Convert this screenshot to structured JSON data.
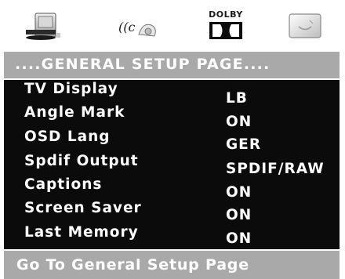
{
  "icons": [
    {
      "name": "general-setup-icon"
    },
    {
      "name": "audio-setup-icon"
    },
    {
      "name": "dolby-icon"
    },
    {
      "name": "preference-icon"
    }
  ],
  "dolby_label": "DOLBY",
  "page_title": "....GENERAL SETUP PAGE....",
  "menu": {
    "items": [
      {
        "label": "TV Display",
        "value": "LB"
      },
      {
        "label": "Angle Mark",
        "value": "ON"
      },
      {
        "label": "OSD Lang",
        "value": "GER"
      },
      {
        "label": "Spdif Output",
        "value": "SPDIF/RAW"
      },
      {
        "label": "Captions",
        "value": "ON"
      },
      {
        "label": "Screen Saver",
        "value": "ON"
      },
      {
        "label": "Last Memory",
        "value": "ON"
      }
    ]
  },
  "footer": {
    "status_text": "Go To General Setup Page"
  },
  "colors": {
    "title_bar": "#a9a9a9",
    "menu_background": "#0b0b0b",
    "text": "#ffffff"
  }
}
